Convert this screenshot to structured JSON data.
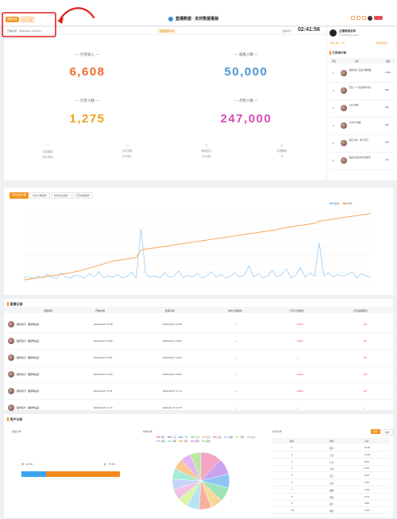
{
  "topbar": {
    "status_badge": "直播结束",
    "mode_badge": "实时大屏",
    "title": "直播数据 · 实时数据看板",
    "time_range": "开播时间：2020-09-27 14:25:51",
    "center_badge": "直播数据分析",
    "duration_label": "直播时长",
    "duration_value": "02:41:56"
  },
  "stats": {
    "income_label": "— 打赏收入 —",
    "income_value": "6,608",
    "watch_label": "— 观看人数 —",
    "watch_value": "50,000",
    "reward_label": "— 打赏人数 —",
    "reward_value": "1,275",
    "total_label": "— 点赞人数 —",
    "total_value": "247,000",
    "small": [
      {
        "label": "评论数量",
        "value": "38,866"
      },
      {
        "label": "分享次数",
        "value": "5,051"
      },
      {
        "label": "新增关注",
        "value": "2,435"
      },
      {
        "label": "礼物数量",
        "value": "3"
      }
    ]
  },
  "anchor": {
    "name": "主播频道名称",
    "id": "ID:1989@xiaoyu2020",
    "tag_a": "关注人数: 2.7万",
    "tag_b": "粉丝团成员"
  },
  "ranking": {
    "title": "打赏排行榜",
    "headers": [
      "排名",
      "用户",
      "金额"
    ],
    "rows": [
      {
        "rank": "1",
        "user": "趣弄官方 正品小猫收集",
        "amount": "2,186"
      },
      {
        "rank": "2",
        "user": "回忆一个过去的时光机",
        "amount": "858"
      },
      {
        "rank": "3",
        "user": "●●●大神●",
        "amount": "555"
      },
      {
        "rank": "4",
        "user": "HAPPY酱酱",
        "amount": "390"
      },
      {
        "rank": "5",
        "user": "橘子大叔 · 狗子日记",
        "amount": "360"
      },
      {
        "rank": "6",
        "user": "趣弄大叔旧时光的夏天",
        "amount": "270"
      }
    ]
  },
  "chart_tabs": [
    "实时在线人数",
    "互动人数趋势",
    "新增关注趋势",
    "打赏金额趋势"
  ],
  "chart_legend": [
    "在线",
    "增长"
  ],
  "chart_data": {
    "type": "line",
    "series": [
      {
        "name": "在线",
        "values": [
          0.05,
          0.06,
          0.04,
          0.08,
          0.05,
          0.1,
          0.06,
          0.04,
          0.12,
          0.06,
          0.05,
          0.09,
          0.07,
          0.05,
          0.11,
          0.06,
          0.14,
          0.05,
          0.08,
          0.06,
          0.1,
          0.05,
          0.07,
          0.13,
          0.05,
          0.75,
          0.1,
          0.06,
          0.08,
          0.05,
          0.12,
          0.06,
          0.07,
          0.15,
          0.05,
          0.09,
          0.06,
          0.11,
          0.05,
          0.08,
          0.14,
          0.06,
          0.1,
          0.05,
          0.07,
          0.12,
          0.06,
          0.09,
          0.22,
          0.06,
          0.11,
          0.05,
          0.08,
          0.16,
          0.06,
          0.1,
          0.18,
          0.05,
          0.09,
          0.2,
          0.06,
          0.12,
          0.07,
          0.55,
          0.08,
          0.12,
          0.06,
          0.1,
          0.07,
          0.09,
          0.14,
          0.05,
          0.11,
          0.08,
          0.06
        ]
      },
      {
        "name": "增长",
        "values": [
          0.02,
          0.03,
          0.04,
          0.05,
          0.06,
          0.07,
          0.08,
          0.09,
          0.1,
          0.11,
          0.12,
          0.14,
          0.15,
          0.17,
          0.19,
          0.21,
          0.23,
          0.25,
          0.27,
          0.29,
          0.3,
          0.31,
          0.32,
          0.33,
          0.34,
          0.45,
          0.46,
          0.47,
          0.48,
          0.49,
          0.5,
          0.51,
          0.52,
          0.53,
          0.54,
          0.55,
          0.56,
          0.57,
          0.58,
          0.59,
          0.6,
          0.61,
          0.62,
          0.63,
          0.64,
          0.65,
          0.66,
          0.67,
          0.68,
          0.69,
          0.7,
          0.71,
          0.72,
          0.73,
          0.74,
          0.76,
          0.77,
          0.78,
          0.79,
          0.8,
          0.81,
          0.82,
          0.83,
          0.86,
          0.87,
          0.88,
          0.89,
          0.9,
          0.91,
          0.92,
          0.93,
          0.94,
          0.95,
          0.96,
          0.97
        ]
      }
    ],
    "colors": [
      "#8cc6f0",
      "#f5a24b"
    ],
    "ylim": [
      0,
      1
    ]
  },
  "detail": {
    "title": "直播记录",
    "headers": [
      "直播用户",
      "开始时间",
      "结束时间",
      "在线人数变化",
      "打赏人数变化",
      "打赏金额变化"
    ],
    "rows": [
      {
        "user": "趣弄官方【趣弄精品】",
        "start": "2020-09-27 13:18",
        "end": "2020-09-27 13:18",
        "c1": "—",
        "c2": "+1000",
        "c3": "+35"
      },
      {
        "user": "趣弄官方【趣弄精品】",
        "start": "2020-09-27 13:20",
        "end": "2020-09-27 13:20",
        "c1": "—",
        "c2": "+1000",
        "c3": "+35"
      },
      {
        "user": "趣弄官方【趣弄精品】",
        "start": "2020-09-27 13:21",
        "end": "2020-09-27 13:22",
        "c1": "—",
        "c2": "—",
        "c3": "+35"
      },
      {
        "user": "趣弄官方【趣弄精品】",
        "start": "2020-09-27 13:26",
        "end": "2020-09-27 13:29",
        "c1": "—",
        "c2": "+1000",
        "c3": "+35"
      },
      {
        "user": "趣弄官方【趣弄精品】",
        "start": "2020-09-27 17:11",
        "end": "2020-09-27 17:14",
        "c1": "—",
        "c2": "+1000",
        "c3": "+35"
      },
      {
        "user": "趣弄官方【趣弄精品】",
        "start": "2020-09-27 17:15",
        "end": "2020-09-27 17:15",
        "c1": "—",
        "c2": "—",
        "c3": "—"
      }
    ]
  },
  "audience": {
    "title": "用户分析",
    "gender_title": "性别分布",
    "gender_female": "男 · 25.0%",
    "gender_male": "女 · 75.0%",
    "gender_female_pct": 25,
    "region_title": "地域分布",
    "region_legend": [
      "浙江",
      "江苏",
      "广东",
      "上海",
      "北京",
      "山东",
      "福建",
      "河南",
      "四川",
      "湖北",
      "湖南",
      "河北",
      "安徽",
      "其他"
    ],
    "pie_colors": [
      "#f4a3c4",
      "#c9a2f0",
      "#8fc4f5",
      "#9fe3b8",
      "#f5d89a",
      "#f7b0a0",
      "#b6e3f2",
      "#d9f5a8",
      "#f2c1e6",
      "#c6d3f7",
      "#a5ecd8",
      "#f8c88f",
      "#e3b5f5",
      "#bfe7a4"
    ],
    "pie_values": [
      12,
      9,
      8,
      8,
      7,
      7,
      7,
      6,
      6,
      6,
      6,
      6,
      6,
      6
    ],
    "province_title": "省份分布",
    "province_toggle": [
      "省份",
      "城市"
    ],
    "province_headers": [
      "排名",
      "省份",
      "占比"
    ],
    "provinces": [
      {
        "rank": "1",
        "name": "浙江",
        "pct": "23.1%"
      },
      {
        "rank": "2",
        "name": "江苏",
        "pct": "12.6%"
      },
      {
        "rank": "3",
        "name": "广东",
        "pct": "8.5%"
      },
      {
        "rank": "4",
        "name": "上海",
        "pct": "6.0%"
      },
      {
        "rank": "5",
        "name": "北京",
        "pct": "5.6%"
      },
      {
        "rank": "6",
        "name": "山东",
        "pct": "4.8%"
      },
      {
        "rank": "7",
        "name": "福建",
        "pct": "4.2%"
      },
      {
        "rank": "8",
        "name": "河南",
        "pct": "3.1%"
      },
      {
        "rank": "9",
        "name": "四川",
        "pct": "2.8%"
      },
      {
        "rank": "10",
        "name": "湖北",
        "pct": "2.4%"
      }
    ]
  },
  "annotation": {
    "color": "#e02020"
  }
}
